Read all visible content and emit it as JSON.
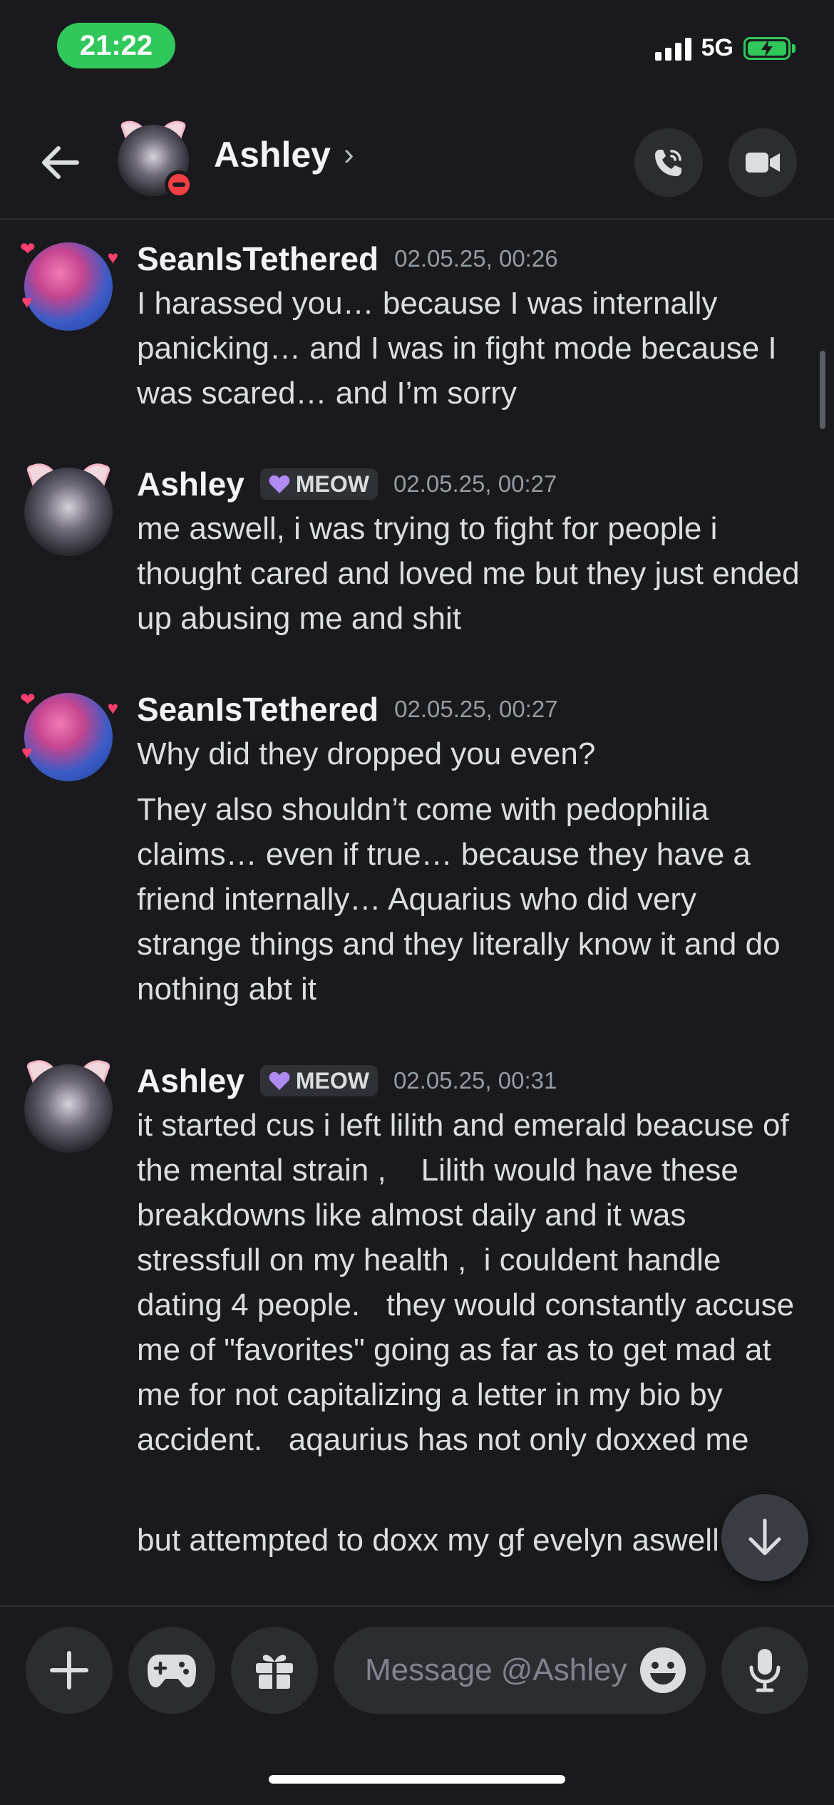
{
  "status_bar": {
    "time": "21:22",
    "network": "5G"
  },
  "header": {
    "title": "Ashley",
    "chevron": "›",
    "status_icon": "do-not-disturb-icon"
  },
  "messages": [
    {
      "author": "SeanIsTethered",
      "timestamp": "02.05.25, 00:26",
      "lines": [
        "I harassed you… because I was internally panicking… and I was in fight mode because I was scared… and I’m sorry"
      ]
    },
    {
      "author": "Ashley",
      "tag": "MEOW",
      "timestamp": "02.05.25, 00:27",
      "lines": [
        "me aswell, i was trying to fight for people i thought cared and loved me but they just ended up abusing me and shit"
      ]
    },
    {
      "author": "SeanIsTethered",
      "timestamp": "02.05.25, 00:27",
      "lines": [
        "Why did they dropped you even?",
        "They also shouldn’t come with pedophilia claims… even if true… because they have a friend internally… Aquarius who did very strange things and they literally know it and do nothing abt it"
      ]
    },
    {
      "author": "Ashley",
      "tag": "MEOW",
      "timestamp": "02.05.25, 00:31",
      "lines": [
        "it started cus i left lilith and emerald beacuse of the mental strain ,    Lilith would have these breakdowns like almost daily and it was stressfull on my health ,  i couldent handle dating 4 people.   they would constantly accuse me of \"favorites\" going as far as to get mad at me for not capitalizing a letter in my bio by accident.   aqaurius has not only doxxed me",
        "but attempted to doxx my gf evelyn aswell"
      ]
    }
  ],
  "composer": {
    "placeholder": "Message @Ashley",
    "icons": [
      "plus-icon",
      "gamepad-icon",
      "gift-icon",
      "emoji-icon",
      "microphone-icon"
    ]
  },
  "colors": {
    "background": "#1a1a1e",
    "accent_green": "#30c85a",
    "tag_heart": "#b089f2"
  }
}
